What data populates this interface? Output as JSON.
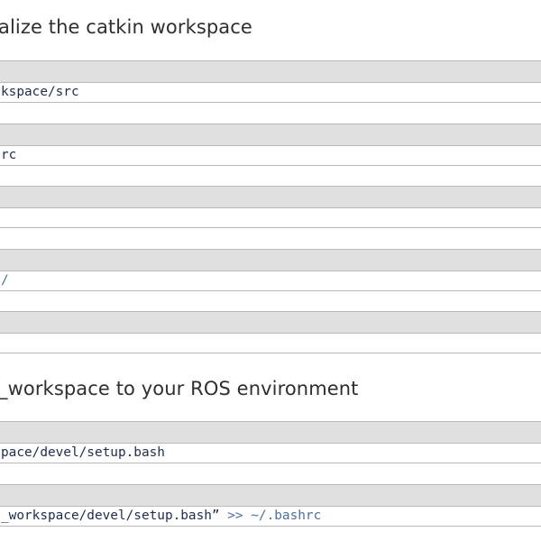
{
  "section1": {
    "heading": "alize the catkin workspace",
    "blocks": [
      {
        "code": "kspace/src"
      },
      {
        "code": "rc"
      },
      {
        "code": ""
      },
      {
        "code": "/"
      },
      {
        "code": ""
      }
    ]
  },
  "section2": {
    "heading": "_workspace to your ROS environment",
    "blocks": [
      {
        "code": "pace/devel/setup.bash"
      },
      {
        "code_part1": "_workspace/devel/setup.bash”",
        "code_op": " >>",
        "code_part2": " ~/.bashrc"
      }
    ]
  },
  "colors": {
    "toolbar": "#e0e0e0",
    "border": "#b9b9b9",
    "code_text": "#1c2c55",
    "operator": "#4a6fb0"
  }
}
